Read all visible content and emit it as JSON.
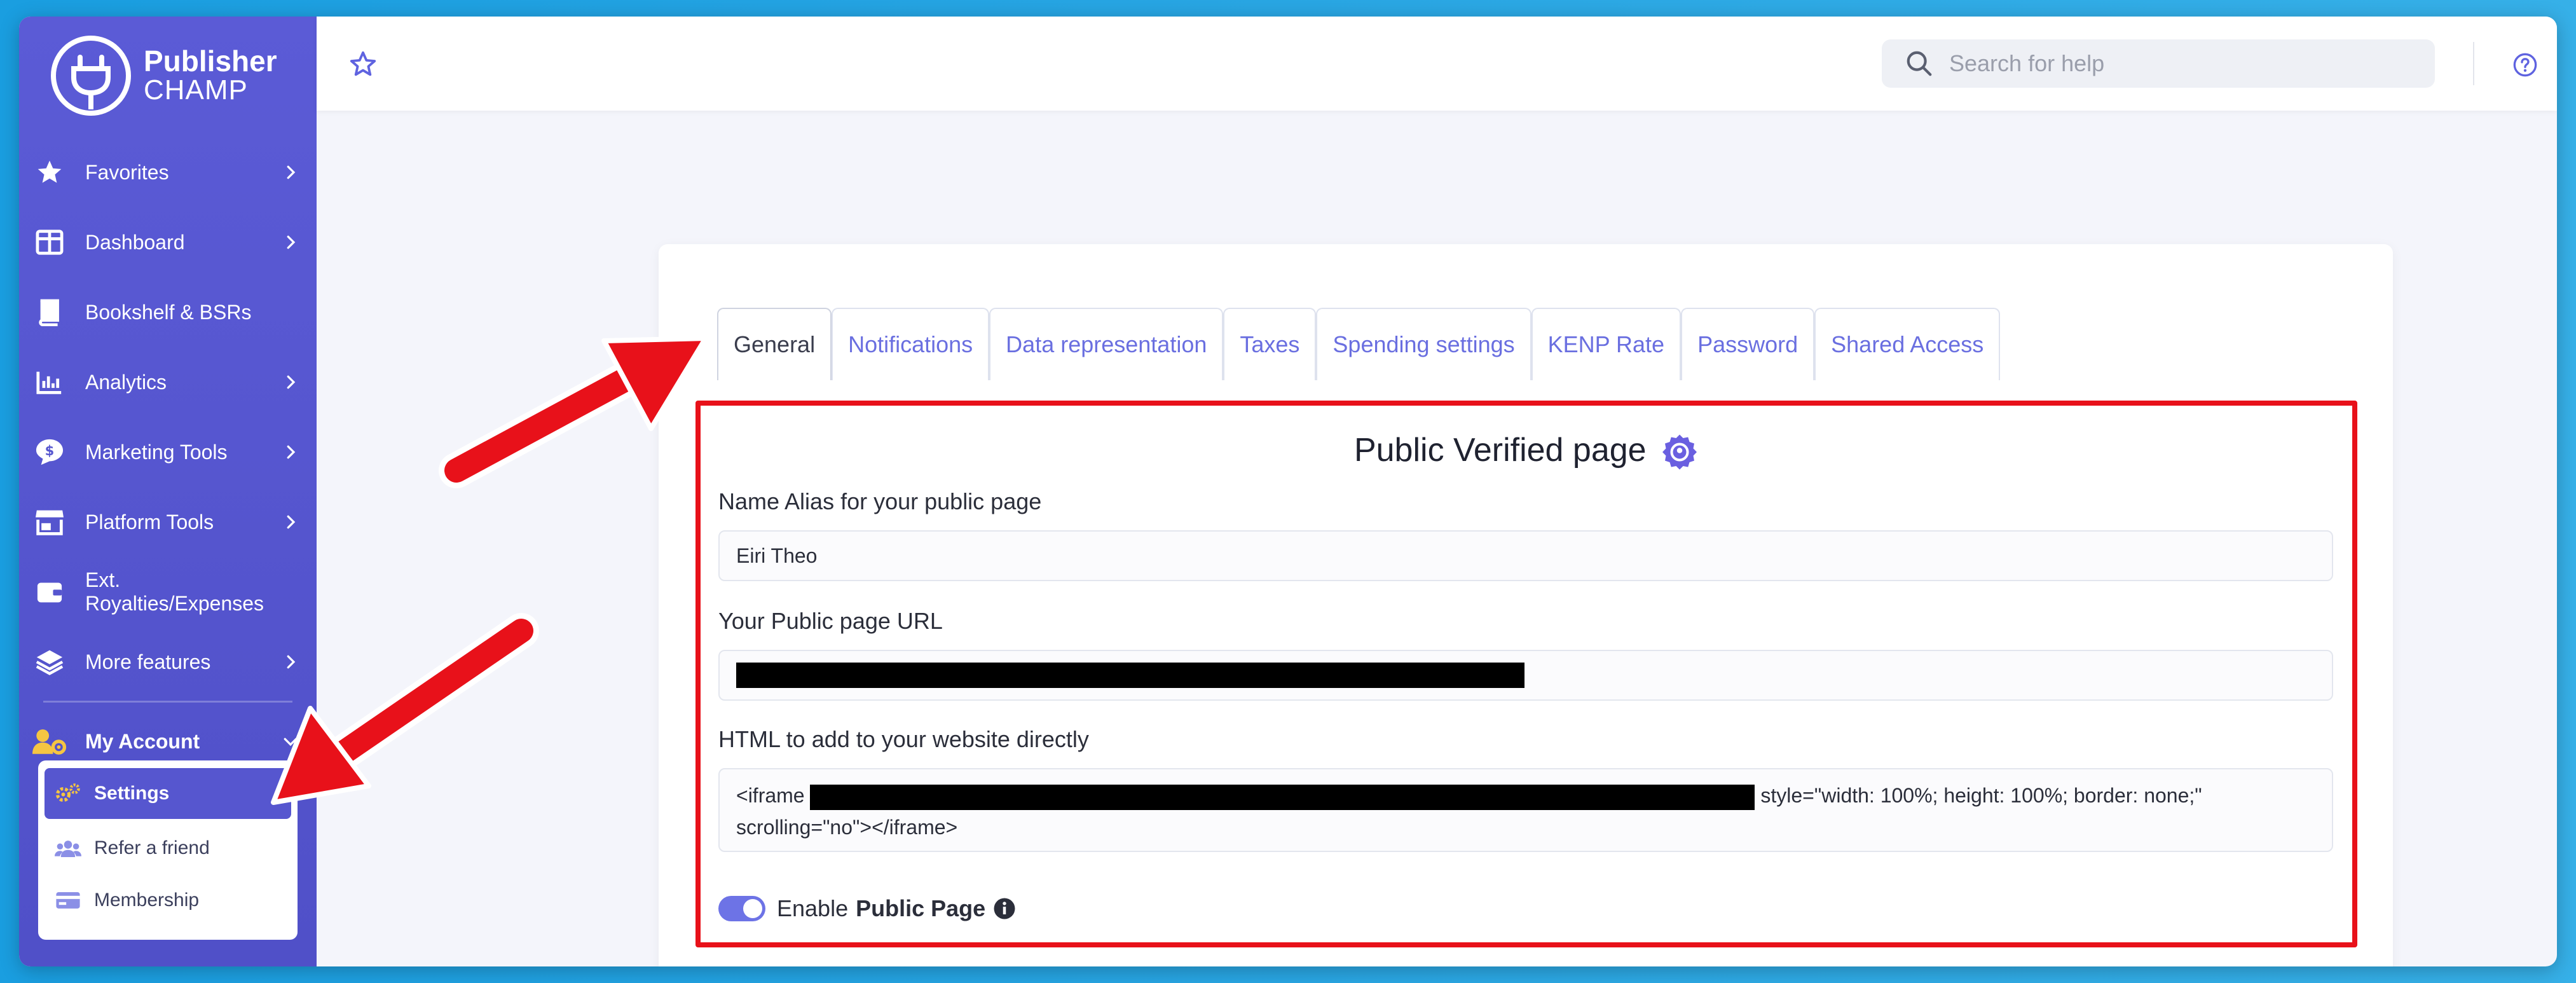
{
  "brand": {
    "line1": "Publisher",
    "line2": "CHAMP"
  },
  "sidebar": {
    "items": [
      {
        "label": "Favorites",
        "icon": "star-icon",
        "chevron": true
      },
      {
        "label": "Dashboard",
        "icon": "dashboard-icon",
        "chevron": true
      },
      {
        "label": "Bookshelf & BSRs",
        "icon": "book-icon",
        "chevron": false
      },
      {
        "label": "Analytics",
        "icon": "bar-chart-icon",
        "chevron": true
      },
      {
        "label": "Marketing Tools",
        "icon": "dollar-chat-icon",
        "chevron": true
      },
      {
        "label": "Platform Tools",
        "icon": "store-icon",
        "chevron": true
      },
      {
        "label": "Ext. Royalties/Expenses",
        "icon": "wallet-icon",
        "chevron": false
      },
      {
        "label": "More features",
        "icon": "layers-icon",
        "chevron": true
      }
    ],
    "account": {
      "label": "My Account",
      "icon": "user-gear-icon"
    },
    "submenu": [
      {
        "label": "Settings",
        "icon": "gears-icon",
        "active": true
      },
      {
        "label": "Refer a friend",
        "icon": "users-icon",
        "active": false
      },
      {
        "label": "Membership",
        "icon": "credit-card-icon",
        "active": false
      }
    ]
  },
  "topbar": {
    "search_placeholder": "Search for help"
  },
  "tabs": [
    {
      "label": "General",
      "active": true
    },
    {
      "label": "Notifications",
      "active": false
    },
    {
      "label": "Data representation",
      "active": false
    },
    {
      "label": "Taxes",
      "active": false
    },
    {
      "label": "Spending settings",
      "active": false
    },
    {
      "label": "KENP Rate",
      "active": false
    },
    {
      "label": "Password",
      "active": false
    },
    {
      "label": "Shared Access",
      "active": false
    }
  ],
  "general": {
    "title": "Public Verified page",
    "alias_label": "Name Alias for your public page",
    "alias_value": "Eiri Theo",
    "url_label": "Your Public page URL",
    "html_label": "HTML to add to your website directly",
    "html_prefix": "<iframe",
    "html_suffix": "style=\"width: 100%; height: 100%; border: none;\"",
    "html_line2": "scrolling=\"no\"></iframe>",
    "toggle_prefix": "Enable",
    "toggle_bold": "Public Page",
    "toggle_on": true
  },
  "colors": {
    "sidebar": "#5656cf",
    "accent": "#6a6fe0",
    "highlight_border": "#e8111a",
    "arrow": "#e8111a",
    "background": "#29a6e3"
  }
}
